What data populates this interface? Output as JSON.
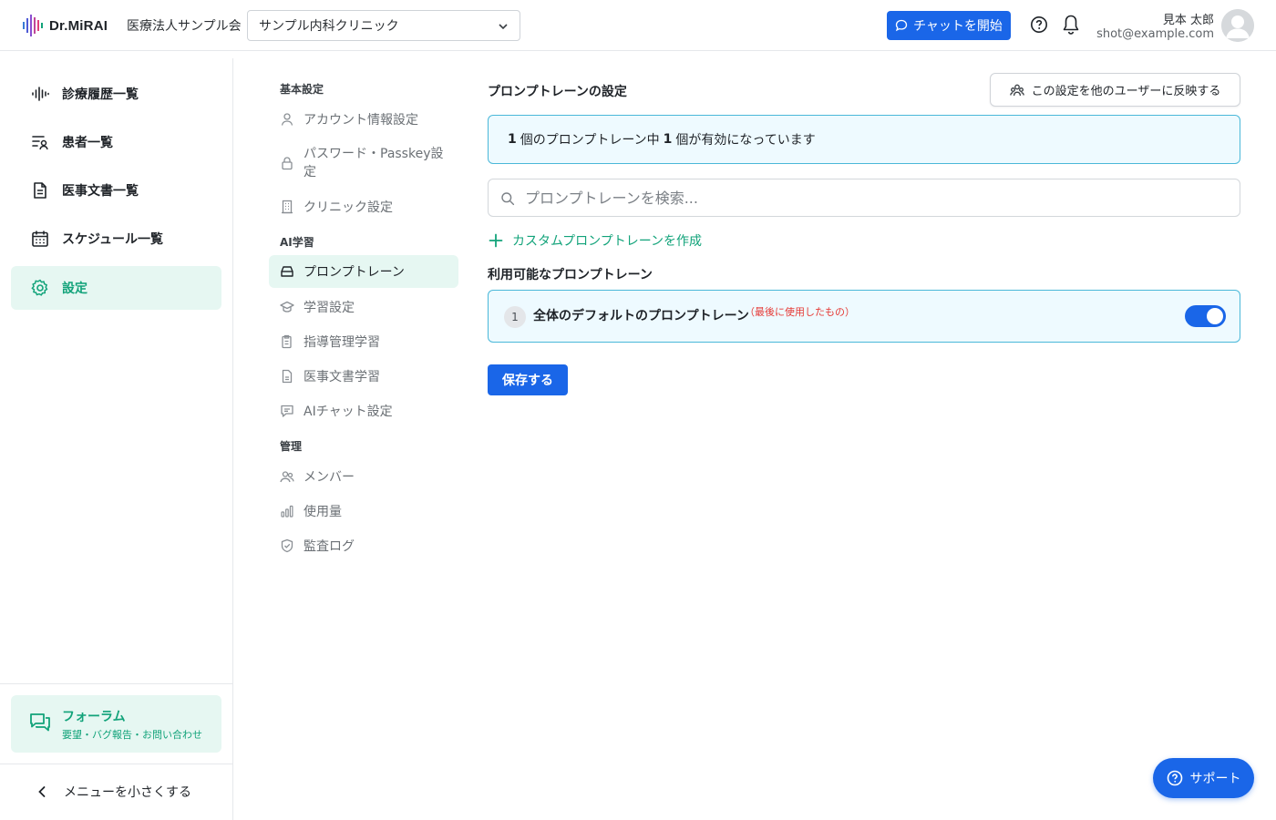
{
  "header": {
    "logo_text": "Dr.MiRAI",
    "org_name": "医療法人サンプル会",
    "clinic_selected": "サンプル内科クリニック",
    "chat_button": "チャットを開始",
    "user_name": "見本 太郎",
    "user_email": "shot@example.com"
  },
  "sidebar": {
    "items": [
      {
        "label": "診療履歴一覧",
        "icon": "waveform-icon"
      },
      {
        "label": "患者一覧",
        "icon": "patient-list-icon"
      },
      {
        "label": "医事文書一覧",
        "icon": "document-icon"
      },
      {
        "label": "スケジュール一覧",
        "icon": "calendar-icon"
      },
      {
        "label": "設定",
        "icon": "gear-icon",
        "active": true
      }
    ],
    "forum_title": "フォーラム",
    "forum_subtitle": "要望・バグ報告・お問い合わせ",
    "collapse_label": "メニューを小さくする"
  },
  "settings_nav": {
    "basic_header": "基本設定",
    "account": "アカウント情報設定",
    "password": "パスワード・Passkey設定",
    "clinic": "クリニック設定",
    "ai_header": "AI学習",
    "prompt_train": "プロンプトレーン",
    "learning": "学習設定",
    "guidance": "指導管理学習",
    "medical_docs": "医事文書学習",
    "ai_chat": "AIチャット設定",
    "admin_header": "管理",
    "members": "メンバー",
    "usage": "使用量",
    "audit": "監査ログ"
  },
  "main": {
    "title": "プロンプトレーンの設定",
    "reflect_button": "この設定を他のユーザーに反映する",
    "info_prefix": "",
    "info_total": "1",
    "info_middle": "個のプロンプトレーン中",
    "info_active": "1",
    "info_suffix": "個が有効になっています",
    "search_placeholder": "プロンプトレーンを検索...",
    "create_link": "カスタムプロンプトレーンを作成",
    "available_title": "利用可能なプロンプトレーン",
    "prompts": [
      {
        "number": "1",
        "name": "全体のデフォルトのプロンプトレーン",
        "tag": "（最後に使用したもの）",
        "enabled": true
      }
    ],
    "save_button": "保存する"
  },
  "support_button": "サポート",
  "colors": {
    "primary": "#1a66e8",
    "accent_green": "#12a37a",
    "active_bg": "#e6f7f2",
    "info_border": "#4ab8d9",
    "info_bg": "#eefaff",
    "tag_red": "#e53935"
  }
}
